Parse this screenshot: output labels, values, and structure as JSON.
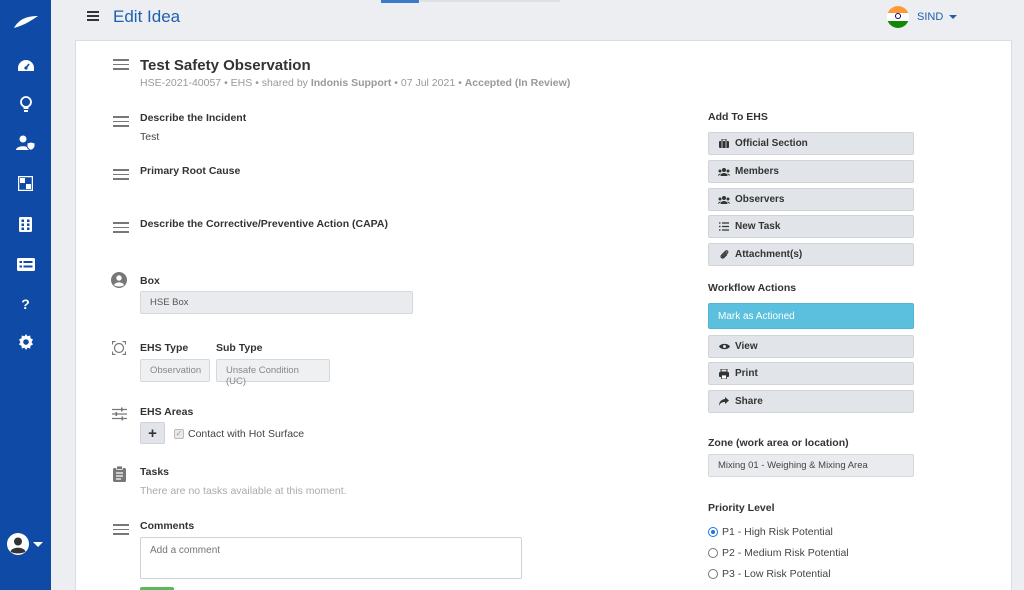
{
  "header": {
    "title": "Edit Idea",
    "user_name": "SIND"
  },
  "idea": {
    "title": "Test Safety Observation",
    "id": "HSE-2021-40057",
    "module": "EHS",
    "shared_by_prefix": "shared by",
    "shared_by": "Indonis Support",
    "date": "07 Jul 2021",
    "status": "Accepted (In Review)",
    "separator": "•"
  },
  "fields": {
    "incident_label": "Describe the Incident",
    "incident_value": "Test",
    "root_cause_label": "Primary Root Cause",
    "capa_label": "Describe the Corrective/Preventive Action (CAPA)",
    "box_label": "Box",
    "box_value": "HSE Box",
    "ehs_type_label": "EHS Type",
    "ehs_type_value": "Observation",
    "sub_type_label": "Sub Type",
    "sub_type_value": "Unsafe Condition (UC)",
    "areas_label": "EHS Areas",
    "area_item": "Contact with Hot Surface",
    "tasks_label": "Tasks",
    "tasks_empty": "There are no tasks available at this moment.",
    "comments_label": "Comments",
    "comment_placeholder": "Add a comment"
  },
  "right": {
    "add_to_label": "Add To EHS",
    "add_buttons": [
      "Official Section",
      "Members",
      "Observers",
      "New Task",
      "Attachment(s)"
    ],
    "workflow_label": "Workflow Actions",
    "workflow_primary": "Mark as Actioned",
    "workflow_buttons": [
      "View",
      "Print",
      "Share"
    ],
    "zone_label": "Zone (work area or location)",
    "zone_value": "Mixing 01 - Weighing & Mixing Area",
    "priority_label": "Priority Level",
    "priority_options": [
      "P1 - High Risk Potential",
      "P2 - Medium Risk Potential",
      "P3 - Low Risk Potential"
    ],
    "priority_selected": 0
  },
  "sidebar_icons": [
    "logo-icon",
    "dashboard-icon",
    "lightbulb-icon",
    "user-shield-icon",
    "grid-icon",
    "calculator-icon",
    "list-icon",
    "help-icon",
    "settings-icon"
  ],
  "colors": {
    "sidebar": "#0f4aa6",
    "title_blue": "#1f5fae",
    "primary_button": "#5bc0de",
    "success": "#5cb85c"
  }
}
